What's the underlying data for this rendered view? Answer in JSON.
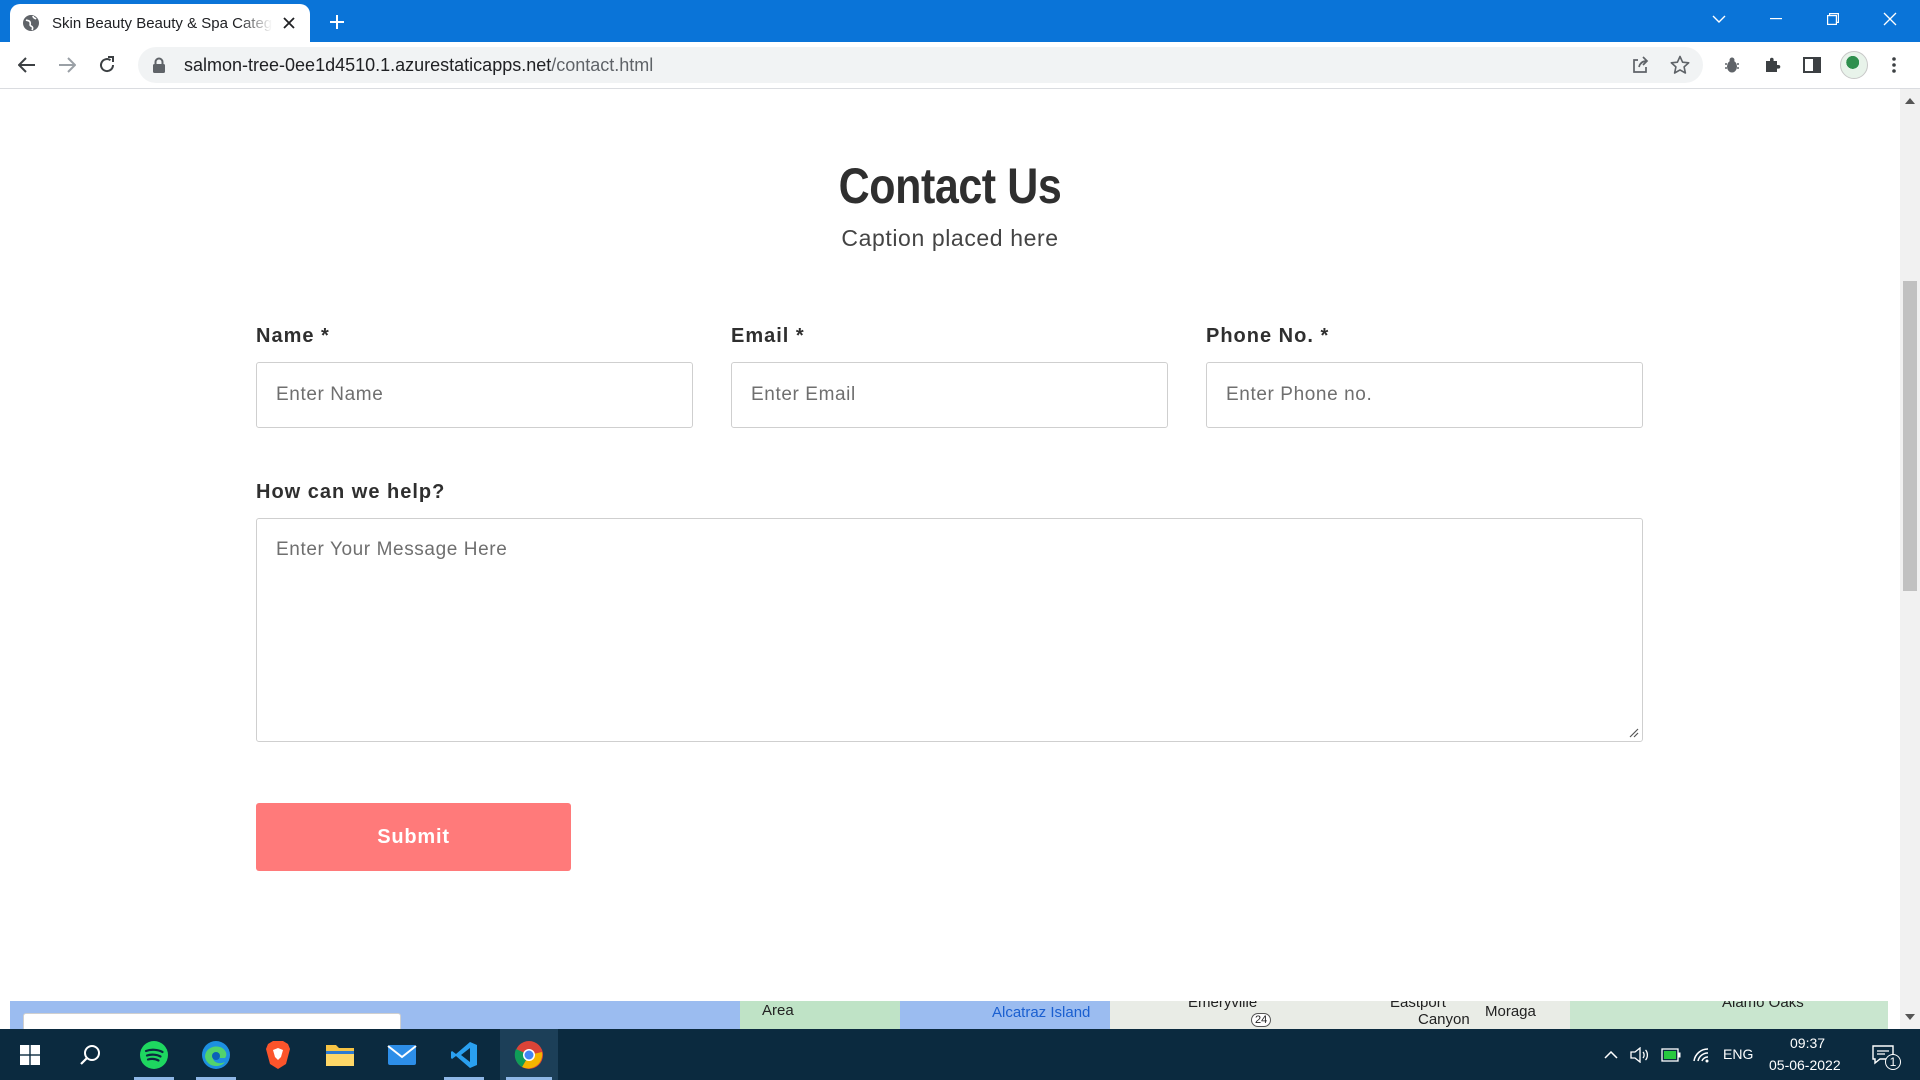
{
  "browser": {
    "tab_title": "Skin Beauty Beauty & Spa Category",
    "url_host": "salmon-tree-0ee1d4510.1.azurestaticapps.net",
    "url_path": "/contact.html",
    "accent": "#0a74d8"
  },
  "page": {
    "title": "Contact Us",
    "caption": "Caption placed here",
    "fields": {
      "name": {
        "label": "Name *",
        "placeholder": "Enter Name"
      },
      "email": {
        "label": "Email *",
        "placeholder": "Enter Email"
      },
      "phone": {
        "label": "Phone No. *",
        "placeholder": "Enter Phone no."
      },
      "message": {
        "label": "How can we help?",
        "placeholder": "Enter Your Message Here"
      }
    },
    "submit_label": "Submit",
    "submit_color": "#ff7a7a",
    "map_labels": {
      "area": "Area",
      "alcatraz": "Alcatraz Island",
      "emeryville": "Emeryville",
      "eastport": "Eastport",
      "canyon": "Canyon",
      "moraga": "Moraga",
      "alamo": "Alamo Oaks",
      "route": "24"
    }
  },
  "taskbar": {
    "language": "ENG",
    "time": "09:37",
    "date": "05-06-2022",
    "notifications": "1"
  }
}
